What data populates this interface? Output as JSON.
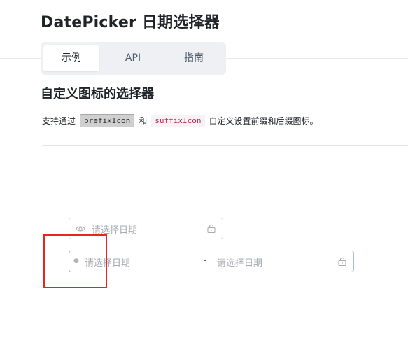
{
  "header": {
    "title": "DatePicker 日期选择器"
  },
  "tabs": [
    {
      "label": "示例",
      "active": true
    },
    {
      "label": "API",
      "active": false
    },
    {
      "label": "指南",
      "active": false
    }
  ],
  "section": {
    "title": "自定义图标的选择器",
    "description": {
      "part1": "支持通过",
      "code1": "prefixIcon",
      "part2": "和",
      "code2": "suffixIcon",
      "part3": "自定义设置前缀和后缀图标。"
    }
  },
  "date_picker": {
    "placeholder": "请选择日期",
    "prefix_icon": "eye-icon",
    "suffix_icon": "lock-icon"
  },
  "range_picker": {
    "start_placeholder": "请选择日期",
    "separator": "-",
    "end_placeholder": "请选择日期",
    "prefix_icon": "dot-icon",
    "suffix_icon": "lock-icon"
  },
  "colors": {
    "annotation_box": "#e8251f",
    "code_text": "#c7254e",
    "placeholder": "#a8abb2"
  }
}
